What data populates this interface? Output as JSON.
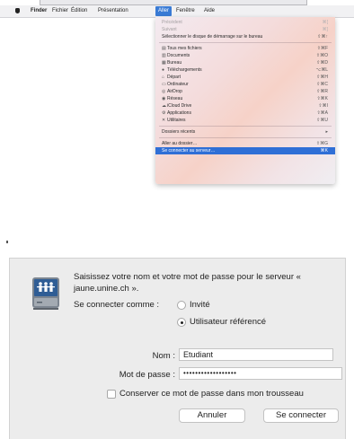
{
  "menubar": {
    "app_name": "Finder",
    "items": [
      "Fichier",
      "Édition",
      "Présentation",
      "Aller",
      "Fenêtre",
      "Aide"
    ],
    "active_index": 3
  },
  "go_menu": {
    "items": [
      {
        "label": "Précédent",
        "shortcut": "⌘[",
        "disabled": true
      },
      {
        "label": "Suivant",
        "shortcut": "⌘]",
        "disabled": true
      },
      {
        "label": "Sélectionner le disque de démarrage sur le bureau",
        "shortcut": "⇧⌘↑"
      },
      {
        "separator": true
      },
      {
        "label": "Tous mes fichiers",
        "shortcut": "⇧⌘F",
        "icon": "▤"
      },
      {
        "label": "Documents",
        "shortcut": "⇧⌘O",
        "icon": "▥"
      },
      {
        "label": "Bureau",
        "shortcut": "⇧⌘D",
        "icon": "▦"
      },
      {
        "label": "Téléchargements",
        "shortcut": "⌥⌘L",
        "icon": "●"
      },
      {
        "label": "Départ",
        "shortcut": "⇧⌘H",
        "icon": "⌂"
      },
      {
        "label": "Ordinateur",
        "shortcut": "⇧⌘C",
        "icon": "▭"
      },
      {
        "label": "AirDrop",
        "shortcut": "⇧⌘R",
        "icon": "◎"
      },
      {
        "label": "Réseau",
        "shortcut": "⇧⌘K",
        "icon": "◉"
      },
      {
        "label": "iCloud Drive",
        "shortcut": "⇧⌘I",
        "icon": "☁"
      },
      {
        "label": "Applications",
        "shortcut": "⇧⌘A",
        "icon": "⚙"
      },
      {
        "label": "Utilitaires",
        "shortcut": "⇧⌘U",
        "icon": "✕"
      },
      {
        "separator": true
      },
      {
        "label": "Dossiers récents",
        "shortcut": "▸"
      },
      {
        "separator": true
      },
      {
        "label": "Aller au dossier…",
        "shortcut": "⇧⌘G"
      },
      {
        "label": "Se connecter au serveur…",
        "shortcut": "⌘K",
        "highlighted": true
      }
    ]
  },
  "dialog": {
    "prompt": "Saisissez votre nom et votre mot de passe pour le serveur « jaune.unine.ch ».",
    "connect_as_label": "Se connecter comme :",
    "guest_label": "Invité",
    "registered_label": "Utilisateur référencé",
    "name_label": "Nom :",
    "name_value": "Etudiant",
    "password_label": "Mot de passe :",
    "password_value": "••••••••••••••••••",
    "remember_label": "Conserver ce mot de passe dans mon trousseau",
    "remember_checked": false,
    "cancel_label": "Annuler",
    "connect_label": "Se connecter",
    "selected_option": "registered"
  }
}
